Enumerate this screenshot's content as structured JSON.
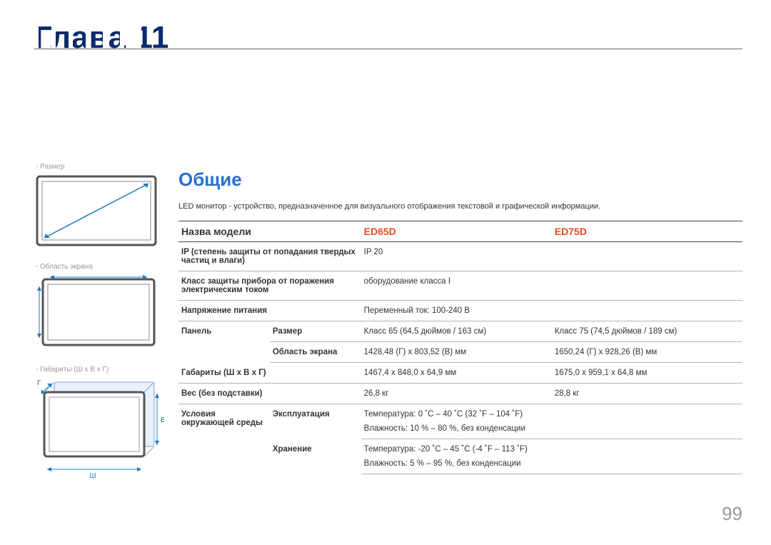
{
  "chapter_title_cut": "Глава 11",
  "page_number": "99",
  "sidebar": {
    "size_label": "Размер",
    "screen_area_label": "Область экрана",
    "dims_label": "Габариты (Ш x В x Г)",
    "axis_w": "Ш",
    "axis_h": "В",
    "axis_d": "Г"
  },
  "section_title": "Общие",
  "intro_text": "LED монитор - устройство, предназначенное для визуального отображения текстовой и графической информации.",
  "table": {
    "header_label": "Назва модели",
    "model_a": "ED65D",
    "model_b": "ED75D",
    "rows": {
      "ip_label": "IP (степень защиты от попадания твердых частиц и влаги)",
      "ip_value": "IP 20",
      "class_label": "Класс защиты прибора от поражения электрическим током",
      "class_value": "оборудование класса I",
      "voltage_label": "Напряжение питания",
      "voltage_value": "Переменный ток: 100-240 В",
      "panel_label": "Панель",
      "panel_size_label": "Размер",
      "panel_size_a": "Класс 65 (64,5 дюймов / 163 см)",
      "panel_size_b": "Класс 75 (74,5 дюймов / 189 см)",
      "panel_area_label": "Область экрана",
      "panel_area_a": "1428,48 (Г) x 803,52 (В) мм",
      "panel_area_b": "1650,24 (Г) x 928,26 (В) мм",
      "dims_label": "Габариты (Ш x В x Г)",
      "dims_a": "1467,4 x 848,0 x 64,9 мм",
      "dims_b": "1675,0 x 959,1 x 64,8 мм",
      "weight_label": "Вес (без подставки)",
      "weight_a": "26,8 кг",
      "weight_b": "28,8 кг",
      "env_label": "Условия окружающей среды",
      "env_op_label": "Эксплуатация",
      "env_op_temp": "Температура: 0 ˚C – 40 ˚C (32 ˚F – 104 ˚F)",
      "env_op_hum": "Влажность: 10 % – 80 %, без конденсации",
      "env_st_label": "Хранение",
      "env_st_temp": "Температура: -20 ˚C – 45 ˚C (-4 ˚F – 113 ˚F)",
      "env_st_hum": "Влажность: 5 % – 95 %, без конденсации"
    }
  }
}
